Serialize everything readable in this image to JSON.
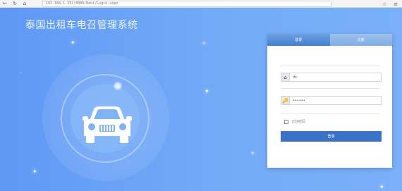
{
  "browser": {
    "back": "←",
    "forward": "→",
    "refresh": "↻",
    "home": "⌂",
    "url": "192.168.1.252:8080/Rent/Login.aspx",
    "star": "☆",
    "menu": "≡"
  },
  "page": {
    "title": "泰国出租车电召管理系统"
  },
  "login": {
    "tab_active": "登录",
    "tab_inactive": "注册",
    "username_icon": "⌂",
    "username_value": "ttc",
    "password_icon": "🔑",
    "password_value": "••••••",
    "remember_label": "记住密码",
    "button_label": "登录"
  }
}
